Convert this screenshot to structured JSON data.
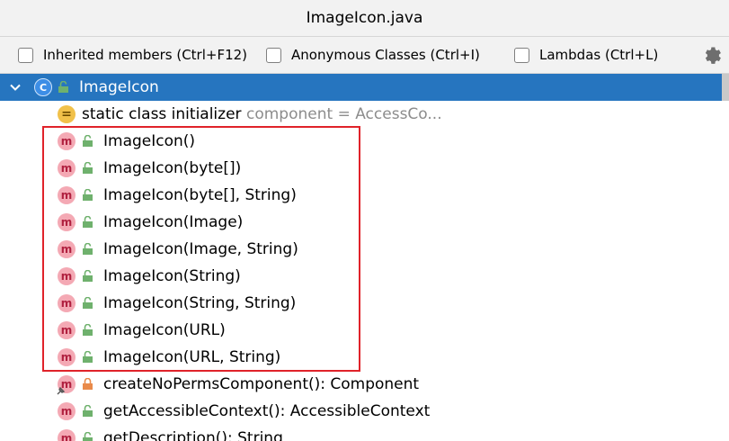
{
  "window": {
    "title": "ImageIcon.java"
  },
  "toolbar": {
    "options": [
      {
        "label": "Inherited members (Ctrl+F12)",
        "checked": false
      },
      {
        "label": "Anonymous Classes (Ctrl+I)",
        "checked": false
      },
      {
        "label": "Lambdas (Ctrl+L)",
        "checked": false
      }
    ],
    "settings_icon": "gear-icon"
  },
  "tree": {
    "root": {
      "label": "ImageIcon",
      "icon": "class-icon",
      "icon_letter": "C",
      "expanded": true
    },
    "items": [
      {
        "label": "static class initializer",
        "hint": "component = AccessCo...",
        "icon": "static-initializer-icon"
      },
      {
        "label": "ImageIcon()",
        "icon": "method-icon",
        "icon_letter": "m",
        "visibility": "public"
      },
      {
        "label": "ImageIcon(byte[])",
        "icon": "method-icon",
        "icon_letter": "m",
        "visibility": "public"
      },
      {
        "label": "ImageIcon(byte[], String)",
        "icon": "method-icon",
        "icon_letter": "m",
        "visibility": "public"
      },
      {
        "label": "ImageIcon(Image)",
        "icon": "method-icon",
        "icon_letter": "m",
        "visibility": "public"
      },
      {
        "label": "ImageIcon(Image, String)",
        "icon": "method-icon",
        "icon_letter": "m",
        "visibility": "public"
      },
      {
        "label": "ImageIcon(String)",
        "icon": "method-icon",
        "icon_letter": "m",
        "visibility": "public"
      },
      {
        "label": "ImageIcon(String, String)",
        "icon": "method-icon",
        "icon_letter": "m",
        "visibility": "public"
      },
      {
        "label": "ImageIcon(URL)",
        "icon": "method-icon",
        "icon_letter": "m",
        "visibility": "public"
      },
      {
        "label": "ImageIcon(URL, String)",
        "icon": "method-icon",
        "icon_letter": "m",
        "visibility": "public"
      },
      {
        "label": "createNoPermsComponent(): Component",
        "icon": "method-icon",
        "icon_letter": "m",
        "visibility": "private"
      },
      {
        "label": "getAccessibleContext(): AccessibleContext",
        "icon": "method-icon",
        "icon_letter": "m",
        "visibility": "public"
      },
      {
        "label": "getDescription(): String",
        "icon": "method-icon",
        "icon_letter": "m",
        "visibility": "public"
      }
    ]
  },
  "colors": {
    "selection": "#2675bf",
    "highlight_box": "#e0232a",
    "method_icon": "#f4a9b4",
    "public_lock": "#6fb16d",
    "private_lock": "#e98a4a"
  }
}
